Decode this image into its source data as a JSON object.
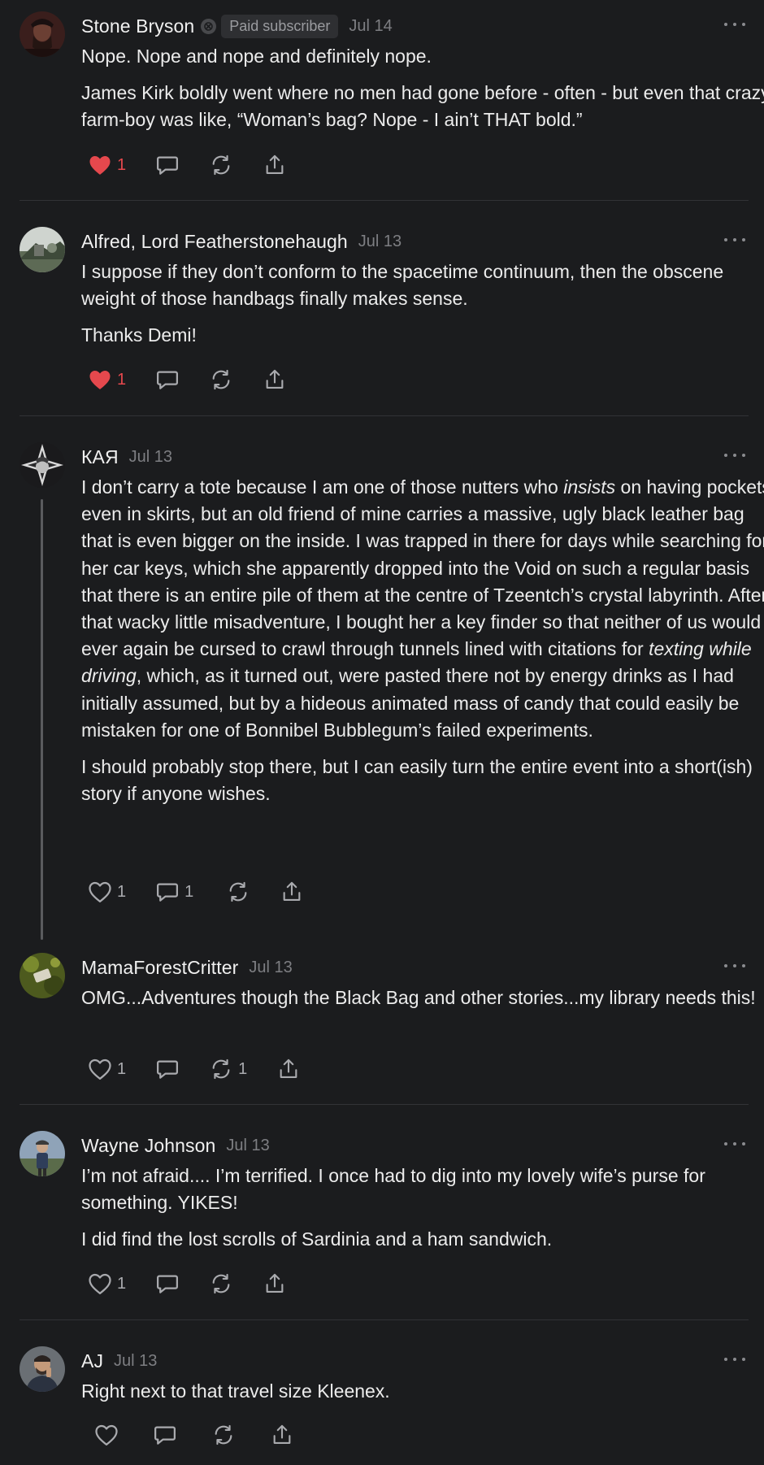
{
  "comments": [
    {
      "author": "Stone Bryson",
      "badge": "Paid subscriber",
      "date": "Jul 14",
      "paragraphs": [
        "Nope. Nope and nope and definitely nope.",
        "James Kirk boldly went where no men had gone before - often - but even that crazy farm-boy was like, “Woman’s bag? Nope - I ain’t THAT bold.”"
      ],
      "likes": "1",
      "liked": true
    },
    {
      "author": "Alfred, Lord Featherstonehaugh",
      "date": "Jul 13",
      "paragraphs": [
        "I suppose if they don’t conform to the spacetime continuum, then the obscene weight of those handbags finally makes sense.",
        "Thanks Demi!"
      ],
      "likes": "1",
      "liked": true
    },
    {
      "author": "КАЯ",
      "date": "Jul 13",
      "p1_a": "I don’t carry a tote because I am one of those nutters who ",
      "p1_em1": "insists",
      "p1_b": " on having pockets even in skirts, but an old friend of mine carries a massive, ugly black leather bag that is even bigger on the inside. I was trapped in there for days while searching for her car keys, which she apparently dropped into the Void on such a regular basis that there is an entire pile of them at the centre of Tzeentch’s crystal labyrinth. After that wacky little misadventure, I bought her a key finder so that neither of us would ever again be cursed to crawl through tunnels lined with citations for ",
      "p1_em2": "texting while driving",
      "p1_c": ", which, as it turned out, were pasted there not by energy drinks as I had initially assumed, but by a hideous animated mass of candy that could easily be mistaken for one of Bonnibel Bubblegum’s failed experiments.",
      "p2": "I should probably stop there, but I can easily turn the entire event into a short(ish) story if anyone wishes.",
      "likes": "1",
      "replies": "1"
    },
    {
      "author": "MamaForestCritter",
      "date": "Jul 13",
      "paragraphs": [
        "OMG...Adventures though the Black Bag and other stories...my library needs this!"
      ],
      "likes": "1",
      "restacks": "1"
    },
    {
      "author": "Wayne Johnson",
      "date": "Jul 13",
      "paragraphs": [
        "I’m not afraid.... I’m terrified. I once had to dig into my lovely wife’s purse for something. YIKES!",
        "I did find the lost scrolls of Sardinia and a ham sandwich."
      ],
      "likes": "1"
    },
    {
      "author": "AJ",
      "date": "Jul 13",
      "paragraphs": [
        "Right next to that travel size Kleenex."
      ]
    }
  ],
  "colors": {
    "background": "#1b1c1e",
    "like_red": "#e5484d",
    "icon_gray": "#a9aaae",
    "date_gray": "#7d7e82"
  },
  "icons": [
    "heart-icon",
    "comment-icon",
    "restack-icon",
    "share-icon",
    "more-icon"
  ]
}
